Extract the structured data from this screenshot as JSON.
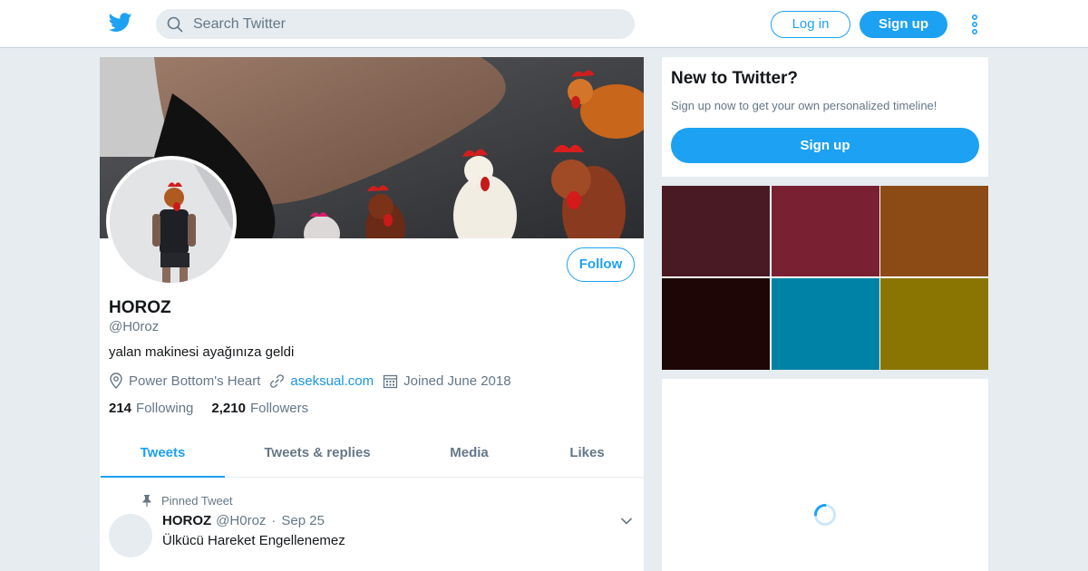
{
  "nav": {
    "search_placeholder": "Search Twitter",
    "login_label": "Log in",
    "signup_label": "Sign up",
    "logo_icon": "twitter-bird-icon",
    "more_icon": "vertical-dots-icon"
  },
  "profile": {
    "name": "HOROZ",
    "handle": "@H0roz",
    "bio": "yalan makinesi ayağınıza geldi",
    "location": "Power Bottom's Heart",
    "website": "aseksual.com",
    "joined": "Joined June 2018",
    "following_count": "214",
    "following_label": "Following",
    "followers_count": "2,210",
    "followers_label": "Followers",
    "follow_label": "Follow"
  },
  "tabs": [
    {
      "label": "Tweets",
      "active": true
    },
    {
      "label": "Tweets & replies",
      "active": false
    },
    {
      "label": "Media",
      "active": false
    },
    {
      "label": "Likes",
      "active": false
    }
  ],
  "pinned_tweet": {
    "pinned_label": "Pinned Tweet",
    "name": "HOROZ",
    "handle": "@H0roz",
    "separator": "·",
    "date": "Sep 25",
    "text": "Ülkücü Hareket Engellenemez"
  },
  "sidebar": {
    "new_title": "New to Twitter?",
    "new_sub": "Sign up now to get your own personalized timeline!",
    "signup_label": "Sign up",
    "swatch_colors": [
      "#4a1a24",
      "#7a2033",
      "#8c4b14",
      "#1f0606",
      "#0082a6",
      "#8a7502"
    ]
  },
  "colors": {
    "accent": "#1da1f2",
    "link": "#1b95e0",
    "muted": "#657786"
  }
}
